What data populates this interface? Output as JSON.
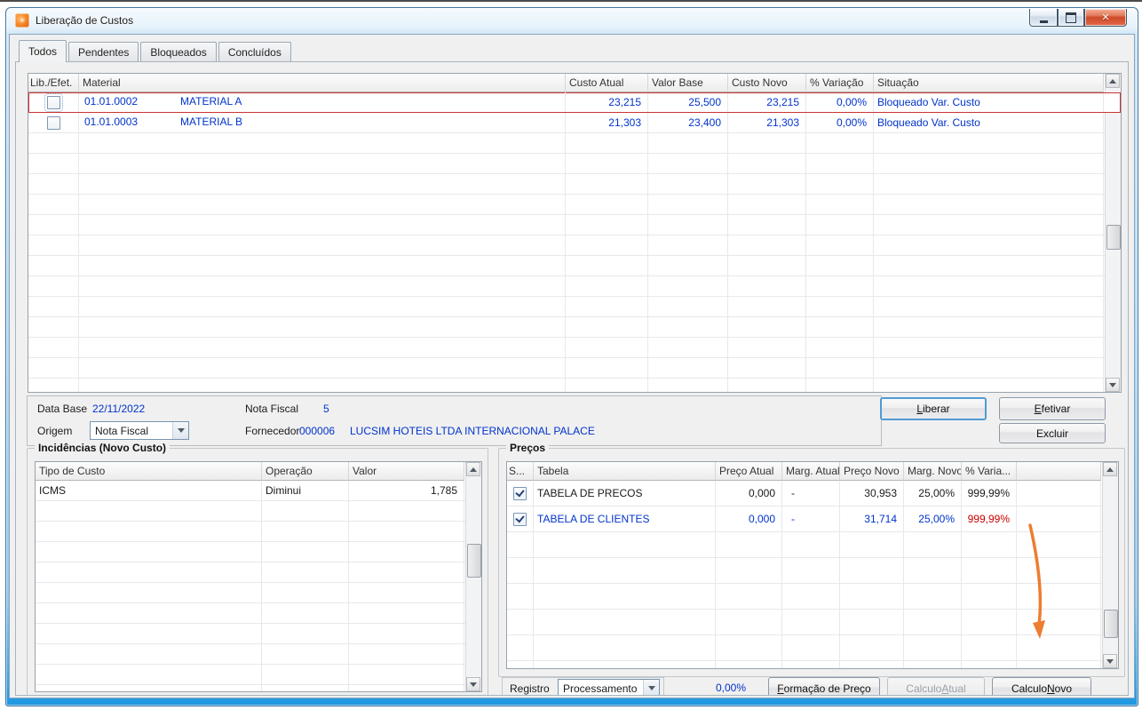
{
  "colors": {
    "data_blue": "#0033CC",
    "alert_red": "#CC0000",
    "row_highlight_red": "#CC3333",
    "annotation_orange": "#ED7D31",
    "frame_blue": "#1E97E0"
  },
  "window": {
    "title": "Liberação de Custos"
  },
  "tabs": [
    {
      "label": "Todos",
      "active": true
    },
    {
      "label": "Pendentes",
      "active": false
    },
    {
      "label": "Bloqueados",
      "active": false
    },
    {
      "label": "Concluídos",
      "active": false
    }
  ],
  "grid": {
    "headers": {
      "lib": "Lib./Efet.",
      "material": "Material",
      "custo_atual": "Custo Atual",
      "valor_base": "Valor Base",
      "custo_novo": "Custo Novo",
      "variacao": "% Variação",
      "situacao": "Situação"
    },
    "rows": [
      {
        "checked": false,
        "code": "01.01.0002",
        "name": "MATERIAL A",
        "custo_atual": "23,215",
        "valor_base": "25,500",
        "custo_novo": "23,215",
        "variacao": "0,00%",
        "situacao": "Bloqueado Var. Custo",
        "highlighted": true
      },
      {
        "checked": false,
        "code": "01.01.0003",
        "name": "MATERIAL B",
        "custo_atual": "21,303",
        "valor_base": "23,400",
        "custo_novo": "21,303",
        "variacao": "0,00%",
        "situacao": "Bloqueado Var. Custo",
        "highlighted": false
      }
    ]
  },
  "info": {
    "data_base_label": "Data Base",
    "data_base_value": "22/11/2022",
    "nota_fiscal_label": "Nota Fiscal",
    "nota_fiscal_value": "5",
    "origem_label": "Origem",
    "origem_value": "Nota Fiscal",
    "fornecedor_label": "Fornecedor",
    "fornecedor_code": "000006",
    "fornecedor_name": "LUCSIM HOTEIS LTDA INTERNACIONAL PALACE"
  },
  "buttons": {
    "liberar": {
      "pre": "",
      "key": "L",
      "post": "iberar"
    },
    "efetivar": {
      "pre": "",
      "key": "E",
      "post": "fetivar"
    },
    "excluir": "Excluir",
    "formacao": {
      "pre": "",
      "key": "F",
      "post": "ormação de Preço"
    },
    "calc_atual": {
      "pre": "Calculo ",
      "key": "A",
      "post": "tual"
    },
    "calc_novo": {
      "pre": "Calculo ",
      "key": "N",
      "post": "ovo"
    }
  },
  "incidencias": {
    "title": "Incidências (Novo Custo)",
    "headers": {
      "tipo": "Tipo de Custo",
      "operacao": "Operação",
      "valor": "Valor"
    },
    "rows": [
      {
        "tipo": "ICMS",
        "operacao": "Diminui",
        "valor": "1,785"
      }
    ]
  },
  "precos": {
    "title": "Preços",
    "headers": {
      "sel": "S...",
      "tabela": "Tabela",
      "preco_atual": "Preço Atual",
      "marg_atual": "Marg. Atual",
      "preco_novo": "Preço Novo",
      "marg_novo": "Marg. Novo",
      "variacao": "% Varia..."
    },
    "rows": [
      {
        "checked": true,
        "tabela": "TABELA DE PRECOS",
        "preco_atual": "0,000",
        "marg_atual": "-",
        "preco_novo": "30,953",
        "marg_novo": "25,00%",
        "variacao": "999,99%",
        "alert": false
      },
      {
        "checked": true,
        "tabela": "TABELA DE CLIENTES",
        "preco_atual": "0,000",
        "marg_atual": "-",
        "preco_novo": "31,714",
        "marg_novo": "25,00%",
        "variacao": "999,99%",
        "alert": true
      }
    ]
  },
  "footer": {
    "registro_label": "Registro",
    "registro_value": "Processamento",
    "percent_value": "0,00%"
  }
}
